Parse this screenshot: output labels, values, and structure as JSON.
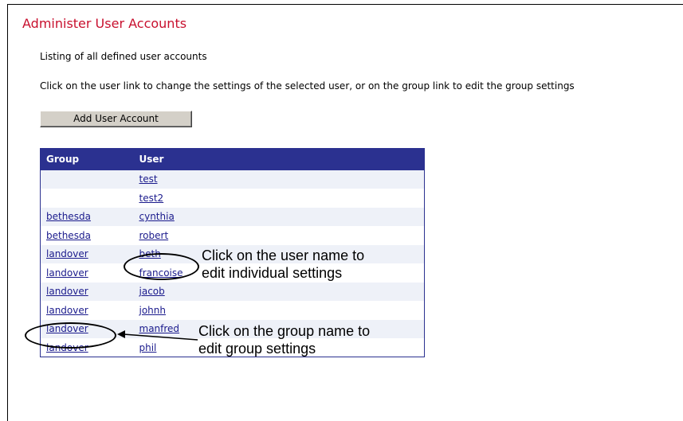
{
  "page": {
    "title": "Administer User Accounts",
    "description": "Listing of all defined user accounts",
    "instructions": "Click on the user link to change the settings of the selected user, or on the group link to edit the group settings"
  },
  "toolbar": {
    "add_user_label": "Add User Account"
  },
  "table": {
    "headers": {
      "group": "Group",
      "user": "User"
    },
    "rows": [
      {
        "group": "",
        "user": "test"
      },
      {
        "group": "",
        "user": "test2"
      },
      {
        "group": "bethesda",
        "user": "cynthia"
      },
      {
        "group": "bethesda",
        "user": "robert"
      },
      {
        "group": "landover",
        "user": "beth"
      },
      {
        "group": "landover",
        "user": "francoise"
      },
      {
        "group": "landover",
        "user": "jacob"
      },
      {
        "group": "landover",
        "user": "johnh"
      },
      {
        "group": "landover",
        "user": "manfred"
      },
      {
        "group": "landover",
        "user": "phil"
      }
    ]
  },
  "annotations": {
    "user_note_line1": "Click on the user name to",
    "user_note_line2": "edit individual settings",
    "group_note_line1": "Click on the group name to",
    "group_note_line2": "edit group settings"
  },
  "colors": {
    "title": "#c8102e",
    "table_header_bg": "#2b3190",
    "link": "#1a1a8c",
    "row_alt_bg": "#eef1f8"
  }
}
